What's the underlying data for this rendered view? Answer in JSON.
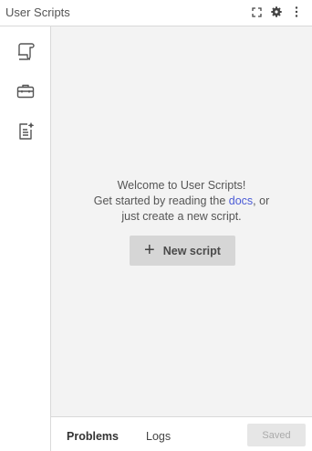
{
  "app": {
    "title": "User Scripts"
  },
  "header": {
    "icons": [
      "expand-icon",
      "gear-icon",
      "more-vertical-icon"
    ]
  },
  "sidebar": {
    "items": [
      {
        "icon": "scroll-icon"
      },
      {
        "icon": "toolbox-icon"
      },
      {
        "icon": "sparkle-document-icon"
      }
    ]
  },
  "welcome": {
    "line1": "Welcome to User Scripts!",
    "line2_prefix": "Get started by reading the ",
    "docs_link": "docs",
    "line2_suffix": ", or",
    "line3": "just create a new script."
  },
  "actions": {
    "new_script": "New script"
  },
  "bottom": {
    "tabs": [
      {
        "label": "Problems",
        "active": true
      },
      {
        "label": "Logs",
        "active": false
      }
    ],
    "saved_label": "Saved"
  },
  "colors": {
    "link": "#4b5bd6",
    "background": "#f3f3f3",
    "button": "#d6d6d6"
  }
}
